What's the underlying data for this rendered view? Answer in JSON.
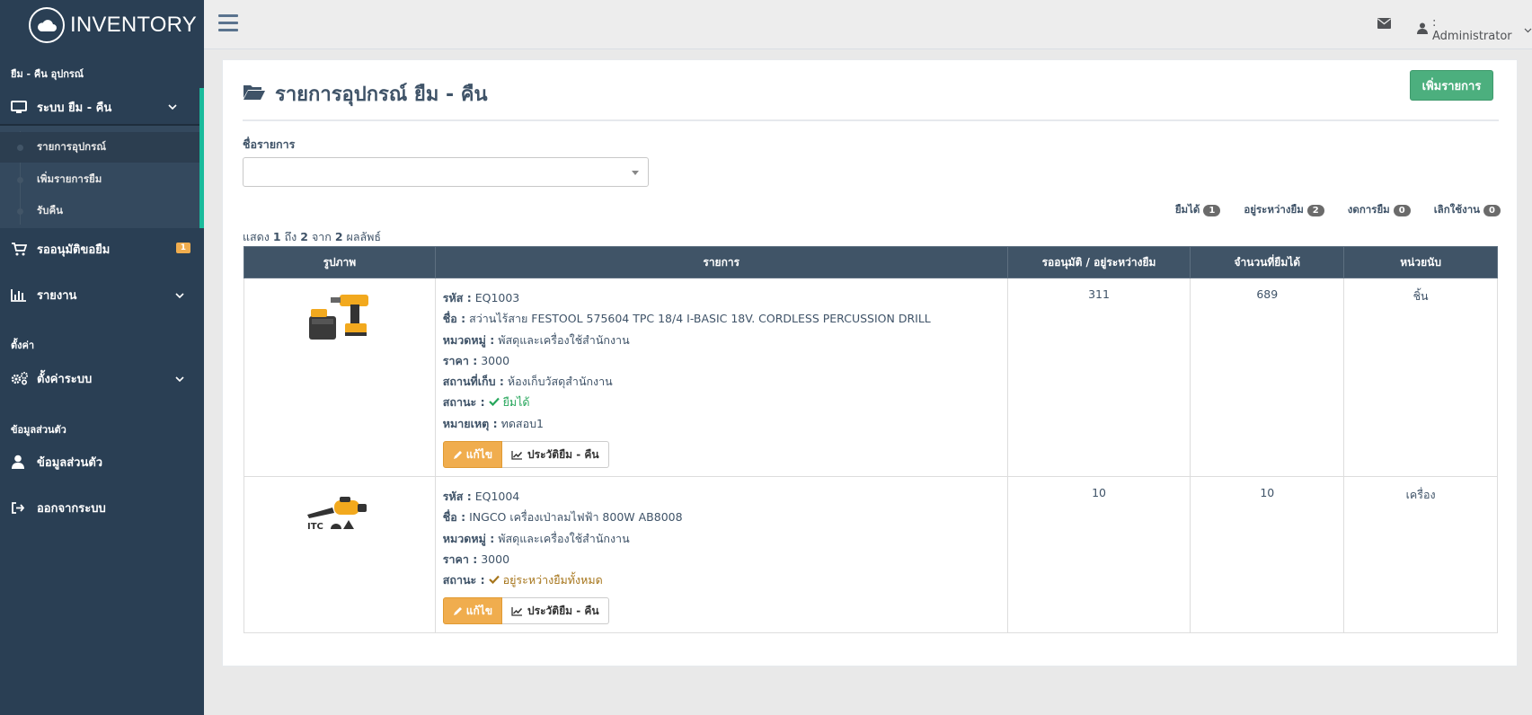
{
  "brand": {
    "title": "INVENTORY"
  },
  "sidebar": {
    "section1": "ยืม - คืน อุปกรณ์",
    "borrow_system": "ระบบ ยืม - คืน",
    "sub_items": [
      "รายการอุปกรณ์",
      "เพิ่มรายการยืม",
      "รับคืน"
    ],
    "approve": "รออนุมัติขอยืม",
    "approve_badge": "1",
    "report": "รายงาน",
    "section2": "ตั้งค่า",
    "settings": "ตั้งค่าระบบ",
    "section3": "ข้อมูลส่วนตัว",
    "profile": "ข้อมูลส่วนตัว",
    "logout": "ออกจากระบบ"
  },
  "topnav": {
    "user": ": Administrator"
  },
  "page": {
    "title": "รายการอุปกรณ์ ยืม - คืน",
    "add_button": "เพิ่มรายการ",
    "filter_label": "ชื่อรายการ",
    "filter_value": ""
  },
  "status": [
    {
      "label": "ยืมได้",
      "count": "1"
    },
    {
      "label": "อยู่ระหว่างยืม",
      "count": "2"
    },
    {
      "label": "งดการยืม",
      "count": "0"
    },
    {
      "label": "เลิกใช้งาน",
      "count": "0"
    }
  ],
  "showing": {
    "prefix": "แสดง",
    "from": "1",
    "to_word": "ถึง",
    "to": "2",
    "of_word": "จาก",
    "total": "2",
    "suffix": "ผลลัพธ์"
  },
  "table": {
    "headers": [
      "รูปภาพ",
      "รายการ",
      "รออนุมัติ / อยู่ระหว่างยืม",
      "จำนวนที่ยืมได้",
      "หน่วยนับ"
    ],
    "rows": [
      {
        "code_label": "รหัส :",
        "code": "EQ1003",
        "name_label": "ชื่อ :",
        "name": "สว่านไร้สาย FESTOOL 575604 TPC 18/4 I-BASIC 18V. CORDLESS PERCUSSION DRILL",
        "category_label": "หมวดหมู่ :",
        "category": "พัสดุและเครื่องใช้สำนักงาน",
        "price_label": "ราคา :",
        "price": "3000",
        "location_label": "สถานที่เก็บ :",
        "location": "ห้องเก็บวัสดุสำนักงาน",
        "status_label": "สถานะ :",
        "status": "ยืมได้",
        "note_label": "หมายเหตุ :",
        "note": "ทดสอบ1",
        "pending": "311",
        "available": "689",
        "unit": "ชิ้น",
        "edit": "แก้ไข",
        "history": "ประวัติยืม - คืน"
      },
      {
        "code_label": "รหัส :",
        "code": "EQ1004",
        "name_label": "ชื่อ :",
        "name": "INGCO เครื่องเป่าลมไฟฟ้า 800W AB8008",
        "category_label": "หมวดหมู่ :",
        "category": "พัสดุและเครื่องใช้สำนักงาน",
        "price_label": "ราคา :",
        "price": "3000",
        "status_label": "สถานะ :",
        "status": "อยู่ระหว่างยืมทั้งหมด",
        "pending": "10",
        "available": "10",
        "unit": "เครื่อง",
        "edit": "แก้ไข",
        "history": "ประวัติยืม - คืน"
      }
    ]
  },
  "colors": {
    "sidebar": "#2a3f54",
    "accent": "#1abb9c",
    "header": "#405467",
    "add_button": "#4caf7e",
    "edit_button": "#f0ad4e"
  }
}
